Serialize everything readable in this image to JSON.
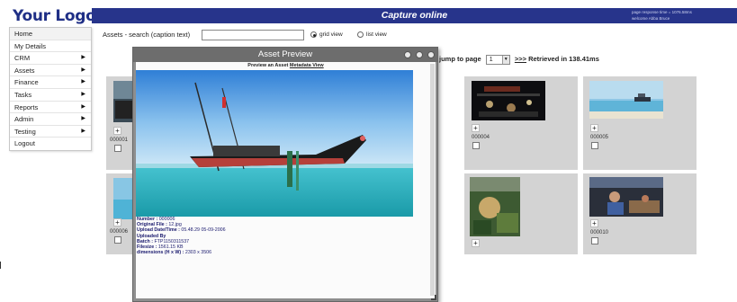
{
  "logo": {
    "text": "Your Logo"
  },
  "header": {
    "title": "Capture online",
    "response_time": "page response time = 1076.58ms",
    "welcome": "welcome Abba Bruce"
  },
  "sidebar": {
    "items": [
      {
        "label": "Home",
        "has_submenu": false
      },
      {
        "label": "My Details",
        "has_submenu": false
      },
      {
        "label": "CRM",
        "has_submenu": true
      },
      {
        "label": "Assets",
        "has_submenu": true
      },
      {
        "label": "Finance",
        "has_submenu": true
      },
      {
        "label": "Tasks",
        "has_submenu": true
      },
      {
        "label": "Reports",
        "has_submenu": true
      },
      {
        "label": "Admin",
        "has_submenu": true
      },
      {
        "label": "Testing",
        "has_submenu": true
      },
      {
        "label": "Logout",
        "has_submenu": false
      }
    ]
  },
  "search": {
    "label": "Assets - search (caption text)",
    "value": "",
    "grid_view_label": "grid view",
    "list_view_label": "list view",
    "selected_view": "grid"
  },
  "pager": {
    "jump_label": "jump to page",
    "page": "1",
    "next_label": ">>>",
    "retrieved": "Retrieved in 138.41ms"
  },
  "grid": {
    "row1_left_label": "000001",
    "row2_left_label": "000006",
    "cell_4_label": "000004",
    "cell_5_label": "000005",
    "cell_10_label": "000010"
  },
  "modal": {
    "title": "Asset Preview",
    "heading_prefix": "Preview an Asset",
    "metadata_link": "Metadata View",
    "meta": {
      "number_label": "Number :",
      "number": "000006",
      "original_file_label": "Original File :",
      "original_file": "12.jpg",
      "upload_label": "Upload Date/Time :",
      "upload": "05.48.29 05-09-2006",
      "uploaded_by_label": "Uploaded By",
      "uploaded_by": "",
      "batch_label": "Batch :",
      "batch": "FTP1150311537",
      "filesize_label": "Filesize :",
      "filesize": "1561.15 KB",
      "dimensions_label": "dimensions (H x W) :",
      "dimensions": "2303 x 3506"
    }
  },
  "colors": {
    "header_bg": "#27348b",
    "logo": "#1f2f86",
    "cell_bg": "#d3d3d3",
    "modal_chrome": "#8e8e8e"
  }
}
